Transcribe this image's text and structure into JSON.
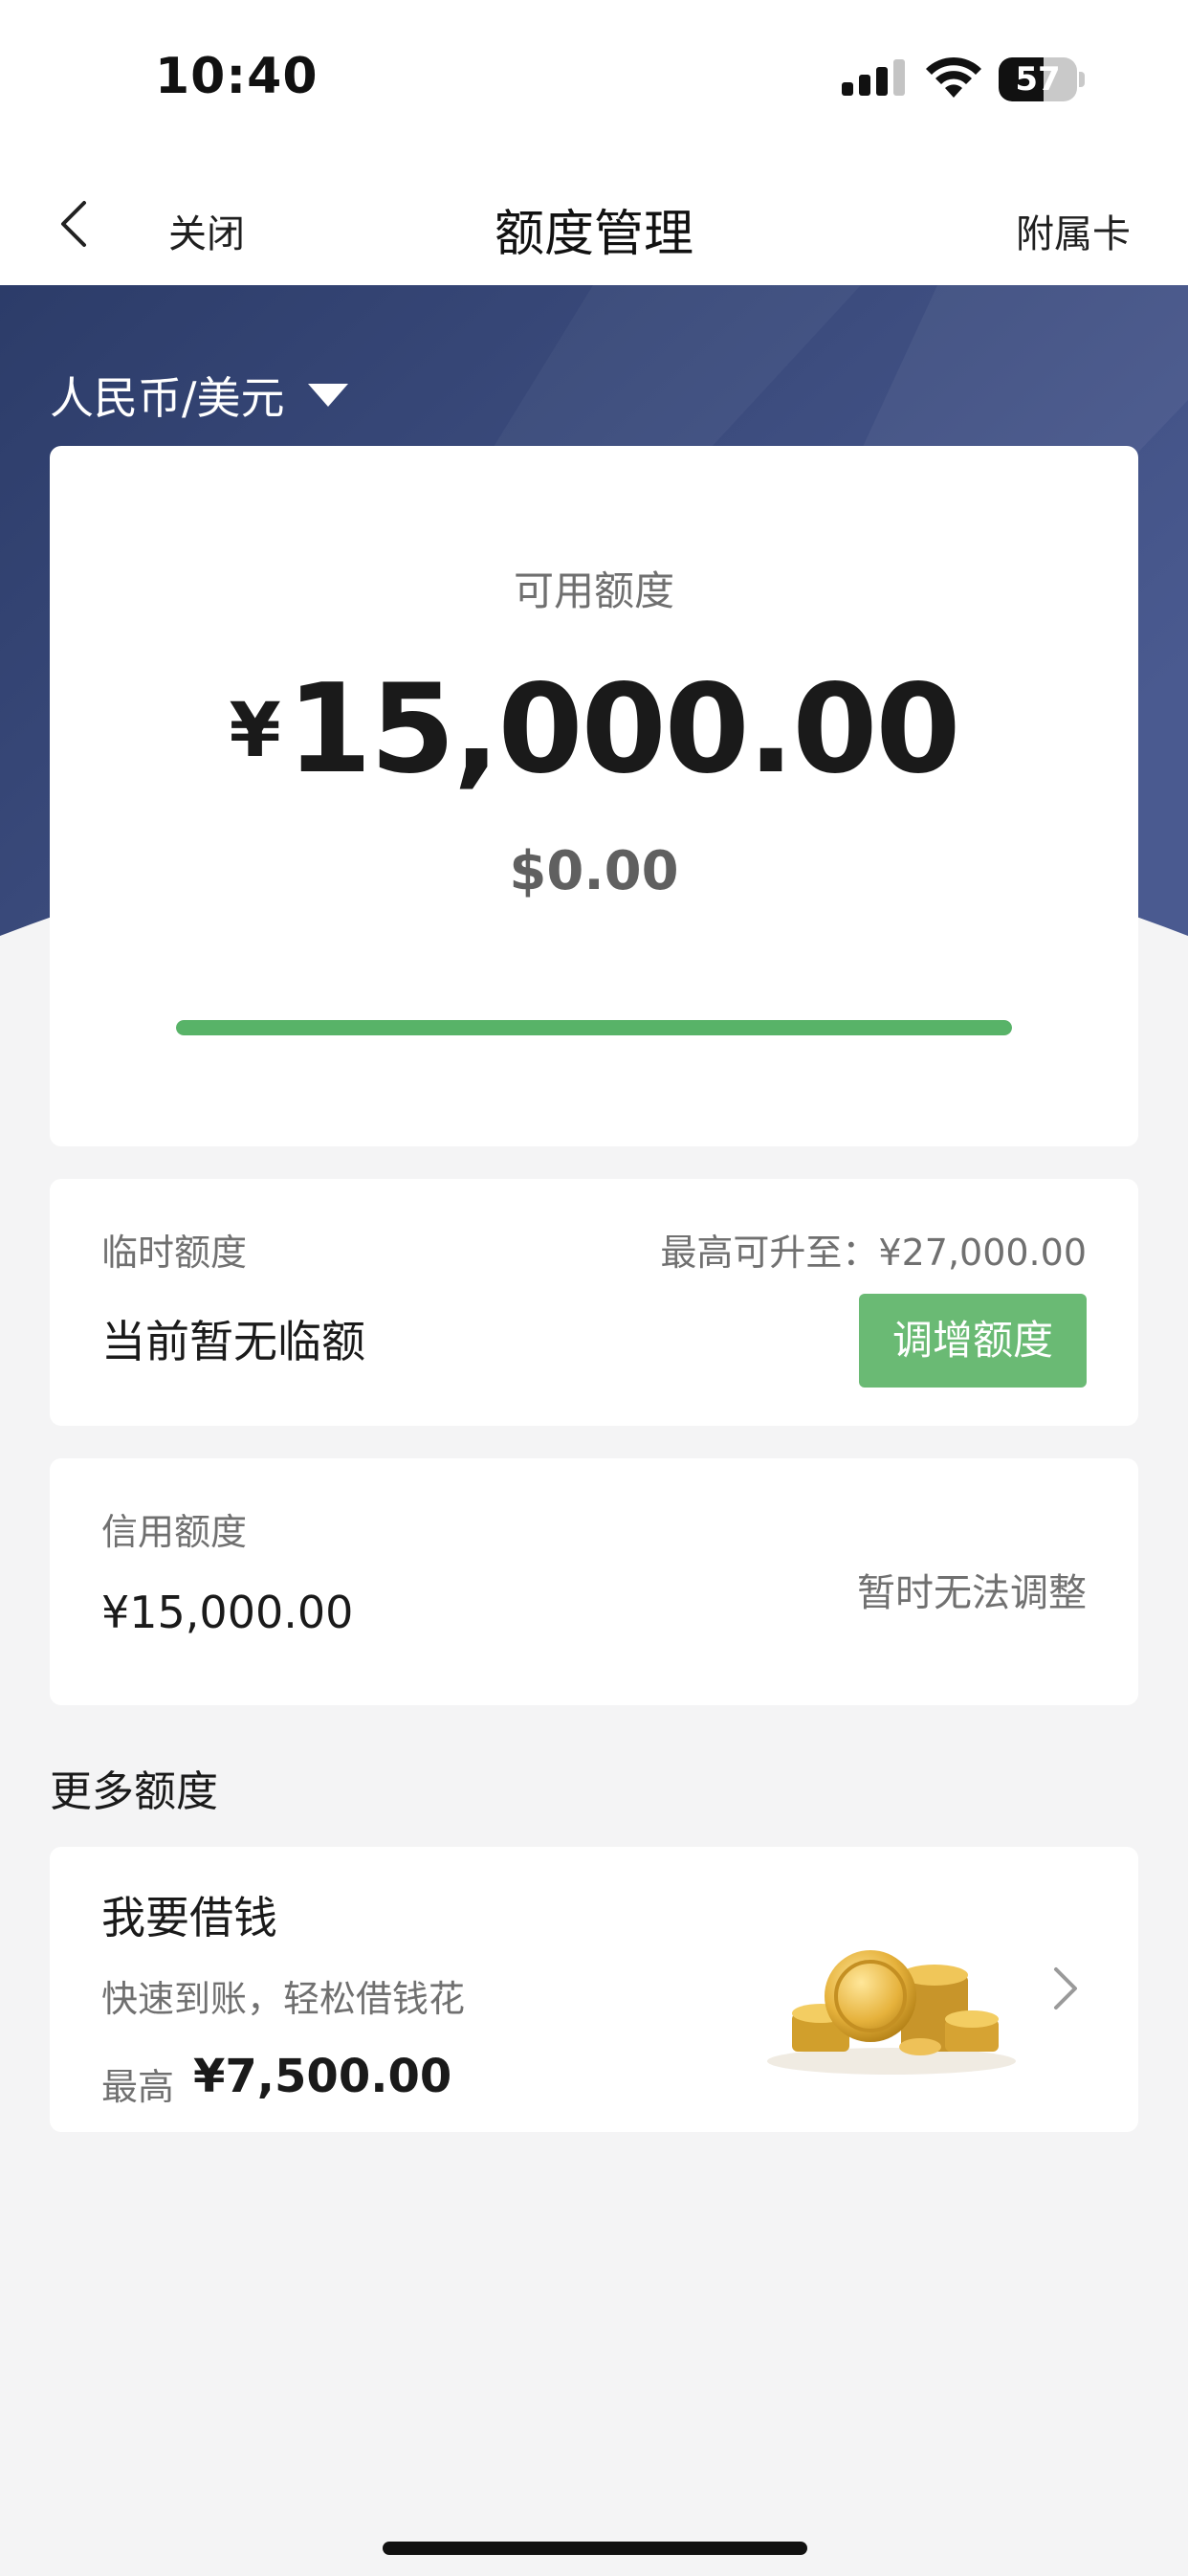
{
  "status_bar": {
    "time": "10:40",
    "battery_level": "57",
    "battery_fraction": 0.57
  },
  "nav": {
    "close_label": "关闭",
    "title": "额度管理",
    "supplementary_card_label": "附属卡"
  },
  "hero": {
    "currency_selector": "人民币/美元",
    "colors": {
      "gradient_start": "#2c3c69",
      "gradient_end": "#4a5a90"
    }
  },
  "available_credit": {
    "label": "可用额度",
    "currency_symbol": "¥",
    "amount": "15,000.00",
    "usd_amount": "$0.00",
    "usage_fraction": 1.0,
    "progress_color": "#58b368"
  },
  "temporary_credit": {
    "label": "临时额度",
    "max_note": "最高可升至：¥27,000.00",
    "status": "当前暂无临额",
    "adjust_button": "调增额度"
  },
  "credit_limit": {
    "label": "信用额度",
    "amount": "¥15,000.00",
    "note": "暂时无法调整"
  },
  "more_credit": {
    "section_title": "更多额度",
    "loan": {
      "title": "我要借钱",
      "subtitle": "快速到账，轻松借钱花",
      "max_label": "最高",
      "max_amount": "¥7,500.00",
      "icon": "coins-icon"
    }
  }
}
